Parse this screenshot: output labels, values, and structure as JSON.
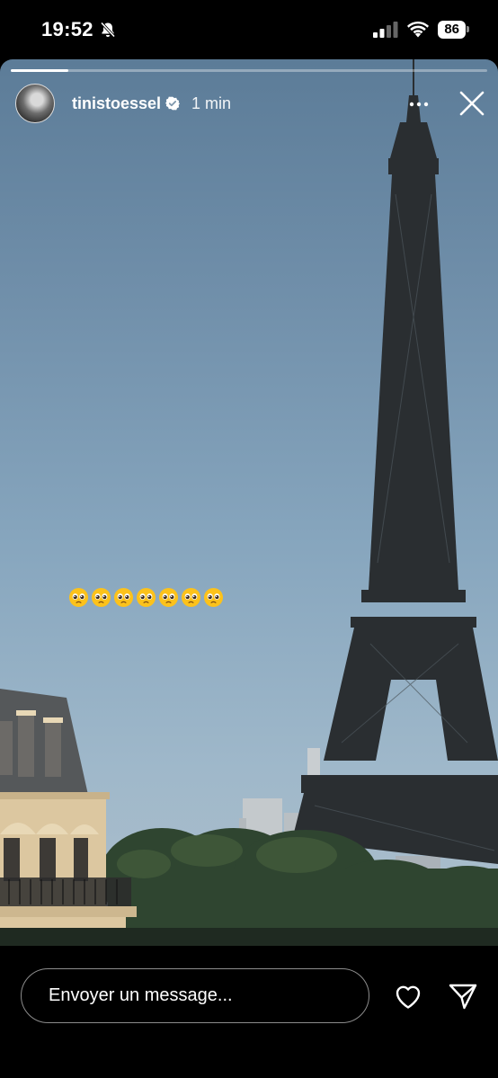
{
  "status_bar": {
    "time": "19:52",
    "battery": "86"
  },
  "story": {
    "progress": 0.12,
    "username": "tinistoessel",
    "time_ago": "1 min",
    "emoji_text": "🥹🥹🥹🥹🥹🥹🥹",
    "emoji_count": 7
  },
  "reply": {
    "placeholder": "Envoyer un message..."
  },
  "icons": {
    "bell": "bell-slash-icon",
    "signal": "cellular-signal-icon",
    "wifi": "wifi-icon",
    "verified": "verified-badge-icon",
    "more": "more-dots-icon",
    "close": "close-icon",
    "like": "heart-icon",
    "share": "send-icon"
  },
  "colors": {
    "accent_verified": "#3897f0",
    "background": "#000000"
  }
}
